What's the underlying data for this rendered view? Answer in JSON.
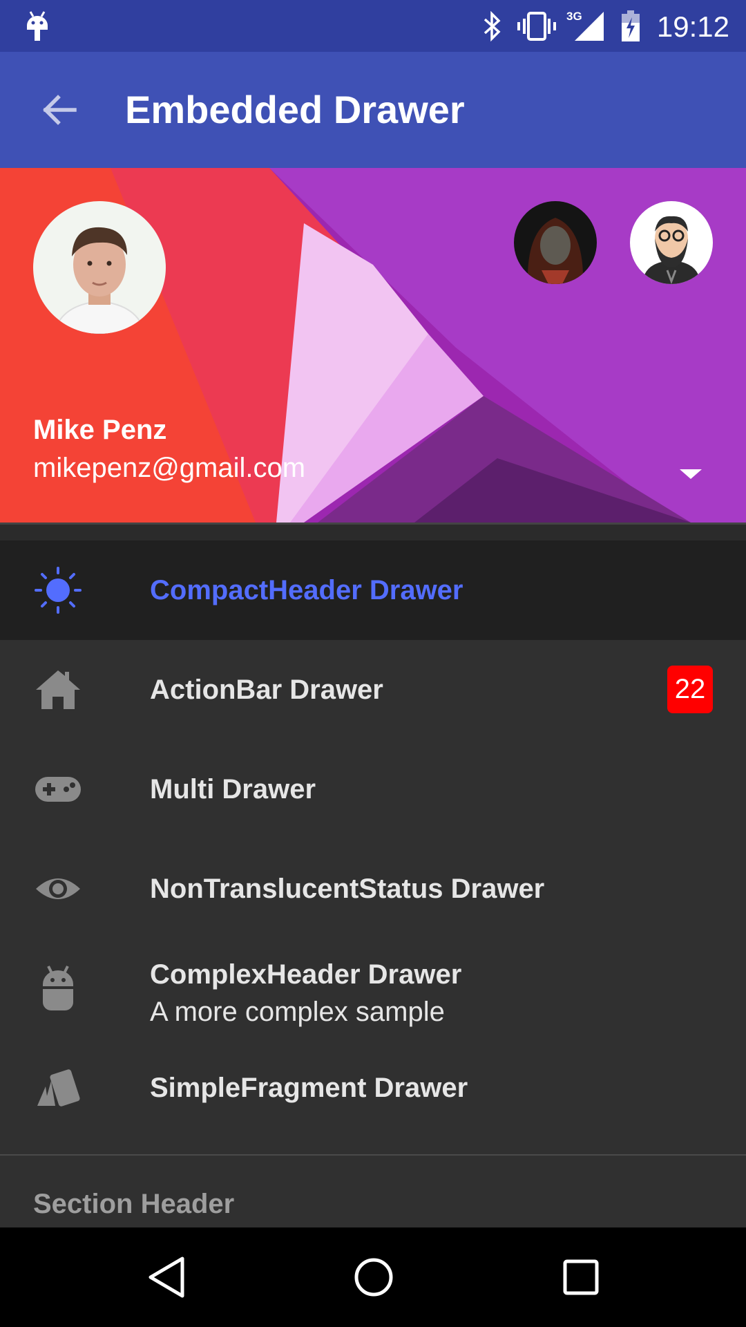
{
  "status_bar": {
    "time": "19:12",
    "network": "3G",
    "icons": [
      "android-notification-icon",
      "bluetooth-icon",
      "vibrate-icon",
      "signal-icon",
      "battery-charging-icon"
    ]
  },
  "app_bar": {
    "title": "Embedded Drawer",
    "back_icon": "arrow-back-icon"
  },
  "profile": {
    "name": "Mike Penz",
    "email": "mikepenz@gmail.com",
    "dropdown_icon": "arrow-drop-down-icon"
  },
  "menu": {
    "items": [
      {
        "label": "CompactHeader Drawer",
        "icon": "sun-icon",
        "selected": true
      },
      {
        "label": "ActionBar Drawer",
        "icon": "home-icon",
        "badge": "22"
      },
      {
        "label": "Multi Drawer",
        "icon": "gamepad-icon"
      },
      {
        "label": "NonTranslucentStatus Drawer",
        "icon": "eye-icon"
      },
      {
        "label": "ComplexHeader Drawer",
        "icon": "android-icon",
        "sub": "A more complex sample"
      },
      {
        "label": "SimpleFragment Drawer",
        "icon": "cards-icon"
      }
    ],
    "section_header": "Section Header"
  },
  "colors": {
    "status_bar": "#303f9f",
    "app_bar": "#3f51b5",
    "accent": "#536dfe",
    "drawer_bg": "#303030",
    "selected_bg": "#202020",
    "badge": "#ff0000"
  }
}
